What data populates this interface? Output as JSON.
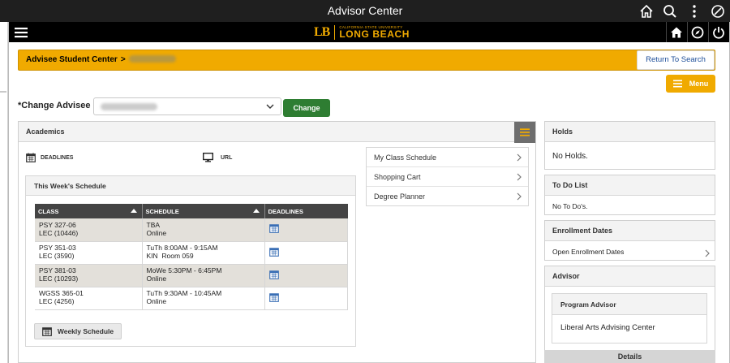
{
  "window": {
    "title": "Advisor Center"
  },
  "brand": {
    "monogram": "LB",
    "university_line": "CALIFORNIA STATE UNIVERSITY",
    "campus": "LONG BEACH",
    "gold": "#f0aa00"
  },
  "banner": {
    "crumb": "Advisee Student Center",
    "separator": ">",
    "return_label": "Return To Search"
  },
  "actions": {
    "menu_label": "Menu"
  },
  "change_advisee": {
    "label": "*Change Advisee",
    "button_label": "Change"
  },
  "academics": {
    "title": "Academics",
    "deadlines_label": "DEADLINES",
    "url_label": "URL",
    "links": [
      "My Class Schedule",
      "Shopping Cart",
      "Degree Planner"
    ]
  },
  "schedule": {
    "title": "This Week's Schedule",
    "columns": [
      "CLASS",
      "SCHEDULE",
      "DEADLINES"
    ],
    "rows": [
      {
        "class_line1": "PSY 327-06",
        "class_line2": "LEC (10446)",
        "sched_line1": "TBA",
        "sched_line2": "Online"
      },
      {
        "class_line1": "PSY 351-03",
        "class_line2": "LEC (3590)",
        "sched_line1": "TuTh 8:00AM - 9:15AM",
        "sched_line2": "KIN  Room 059"
      },
      {
        "class_line1": "PSY 381-03",
        "class_line2": "LEC (10293)",
        "sched_line1": "MoWe 5:30PM - 6:45PM",
        "sched_line2": "Online"
      },
      {
        "class_line1": "WGSS 365-01",
        "class_line2": "LEC (4256)",
        "sched_line1": "TuTh 9:30AM - 10:45AM",
        "sched_line2": "Online"
      }
    ],
    "weekly_button": "Weekly Schedule"
  },
  "holds": {
    "title": "Holds",
    "body": "No Holds."
  },
  "todo": {
    "title": "To Do List",
    "body": "No To Do's."
  },
  "enrollment": {
    "title": "Enrollment Dates",
    "link": "Open Enrollment Dates"
  },
  "advisor": {
    "title": "Advisor",
    "inner_title": "Program Advisor",
    "name": "Liberal Arts Advising Center",
    "details_label": "Details"
  }
}
